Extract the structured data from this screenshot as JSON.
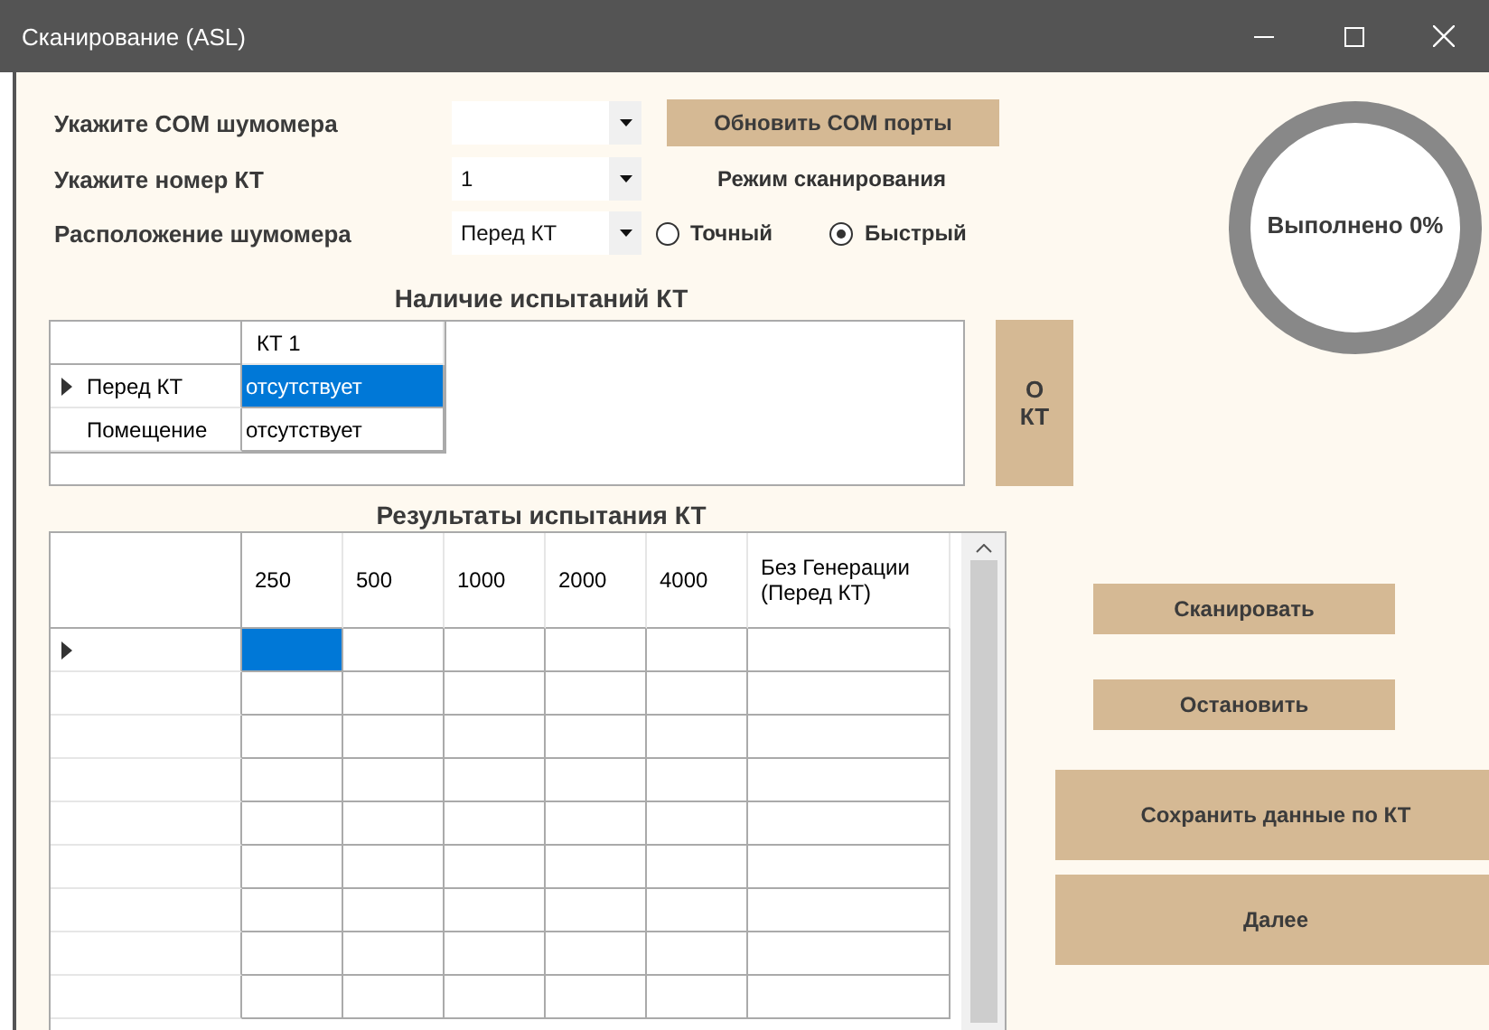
{
  "window": {
    "title": "Сканирование (ASL)"
  },
  "fields": [
    {
      "label": "Укажите COM шумомера"
    },
    {
      "label": "Укажите номер КТ",
      "value": "1"
    },
    {
      "label": "Расположение шумомера",
      "value": "Перед КТ"
    }
  ],
  "refresh_button": "Обновить COM порты",
  "scan_mode": {
    "label": "Режим сканирования",
    "options": [
      {
        "label": "Точный",
        "selected": false
      },
      {
        "label": "Быстрый",
        "selected": true
      }
    ]
  },
  "progress": {
    "label": "Выполнено 0%",
    "level": 0
  },
  "availability": {
    "title": "Наличие испытаний КТ",
    "columns": [
      "КТ 1"
    ],
    "rows": [
      {
        "header": "Перед КТ",
        "current": true,
        "cells": [
          {
            "text": "отсутствует",
            "selected": true
          }
        ]
      },
      {
        "header": "Помещение",
        "current": false,
        "cells": [
          {
            "text": "отсутствует",
            "selected": false
          }
        ]
      }
    ]
  },
  "about_button": "О КТ",
  "results": {
    "title": "Результаты испытания КТ",
    "columns": [
      "250",
      "500",
      "1000",
      "2000",
      "4000",
      "Без Генерации (Перед КТ)"
    ],
    "rows": [
      {
        "current": true,
        "cells": [
          {
            "selected": true
          },
          {
            "selected": false
          },
          {
            "selected": false
          },
          {
            "selected": false
          },
          {
            "selected": false
          },
          {
            "selected": false
          }
        ]
      },
      {
        "current": false,
        "cells": [
          {
            "selected": false
          },
          {
            "selected": false
          },
          {
            "selected": false
          },
          {
            "selected": false
          },
          {
            "selected": false
          },
          {
            "selected": false
          }
        ]
      },
      {
        "current": false,
        "cells": [
          {
            "selected": false
          },
          {
            "selected": false
          },
          {
            "selected": false
          },
          {
            "selected": false
          },
          {
            "selected": false
          },
          {
            "selected": false
          }
        ]
      },
      {
        "current": false,
        "cells": [
          {
            "selected": false
          },
          {
            "selected": false
          },
          {
            "selected": false
          },
          {
            "selected": false
          },
          {
            "selected": false
          },
          {
            "selected": false
          }
        ]
      },
      {
        "current": false,
        "cells": [
          {
            "selected": false
          },
          {
            "selected": false
          },
          {
            "selected": false
          },
          {
            "selected": false
          },
          {
            "selected": false
          },
          {
            "selected": false
          }
        ]
      },
      {
        "current": false,
        "cells": [
          {
            "selected": false
          },
          {
            "selected": false
          },
          {
            "selected": false
          },
          {
            "selected": false
          },
          {
            "selected": false
          },
          {
            "selected": false
          }
        ]
      },
      {
        "current": false,
        "cells": [
          {
            "selected": false
          },
          {
            "selected": false
          },
          {
            "selected": false
          },
          {
            "selected": false
          },
          {
            "selected": false
          },
          {
            "selected": false
          }
        ]
      },
      {
        "current": false,
        "cells": [
          {
            "selected": false
          },
          {
            "selected": false
          },
          {
            "selected": false
          },
          {
            "selected": false
          },
          {
            "selected": false
          },
          {
            "selected": false
          }
        ]
      },
      {
        "current": false,
        "cells": [
          {
            "selected": false
          },
          {
            "selected": false
          },
          {
            "selected": false
          },
          {
            "selected": false
          },
          {
            "selected": false
          },
          {
            "selected": false
          }
        ]
      }
    ]
  },
  "buttons": [
    {
      "label": "Сканировать",
      "kind": "small"
    },
    {
      "label": "Остановить",
      "kind": "small"
    },
    {
      "label": "Сохранить данные по КТ",
      "kind": "large"
    },
    {
      "label": "Далее",
      "kind": "large"
    }
  ]
}
